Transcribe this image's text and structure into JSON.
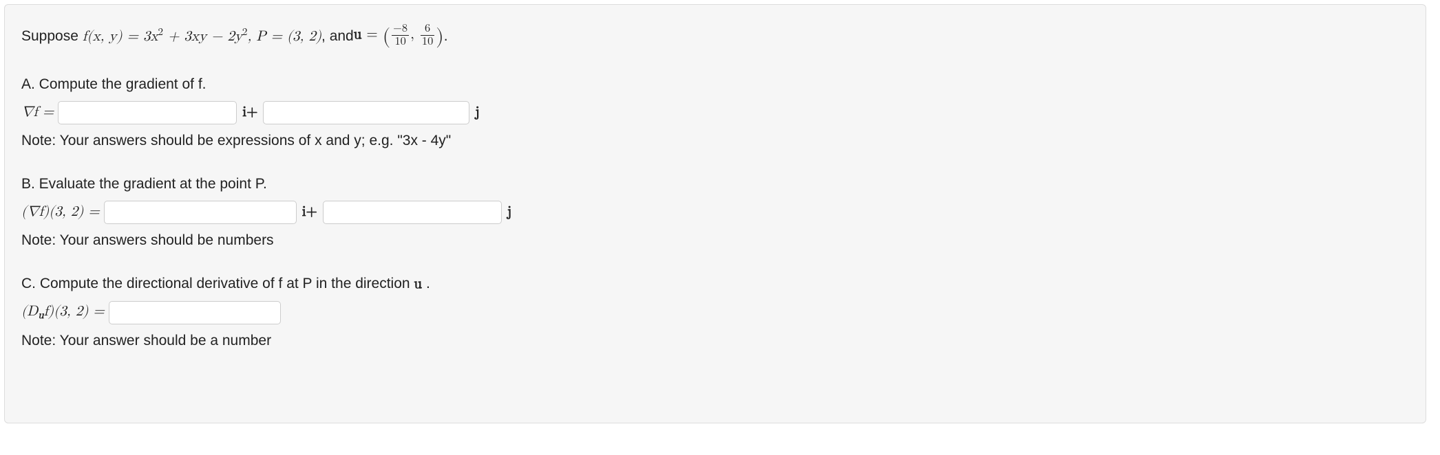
{
  "intro": {
    "prefix": "Suppose ",
    "fxy": "f(x, y) = 3x",
    "sq1": "2",
    "term2": " + 3xy − 2y",
    "sq2": "2",
    "comma_p": ", P = (3, 2)",
    "and": ", and ",
    "u": "u",
    "eq": " = ",
    "lparen": "(",
    "frac1_num": "−8",
    "frac1_den": "10",
    "comma": ", ",
    "frac2_num": "6",
    "frac2_den": "10",
    "rparen": ")",
    "period": "."
  },
  "partA": {
    "prompt": "A. Compute the gradient of f.",
    "grad": "∇f = ",
    "i_plus": "i+",
    "j": "j",
    "note": "Note: Your answers should be expressions of x and y; e.g. \"3x - 4y\""
  },
  "partB": {
    "prompt": "B. Evaluate the gradient at the point P.",
    "lhs": "(∇f)(3, 2) = ",
    "i_plus": "i+",
    "j": "j",
    "note": "Note: Your answers should be numbers"
  },
  "partC": {
    "prompt_pre": "C. Compute the directional derivative of f at P in the direction ",
    "u": "u",
    "prompt_post": " .",
    "lhs_open": "(D",
    "lhs_u": "u",
    "lhs_rest": "f)(3, 2) = ",
    "note": "Note: Your answer should be a number"
  }
}
